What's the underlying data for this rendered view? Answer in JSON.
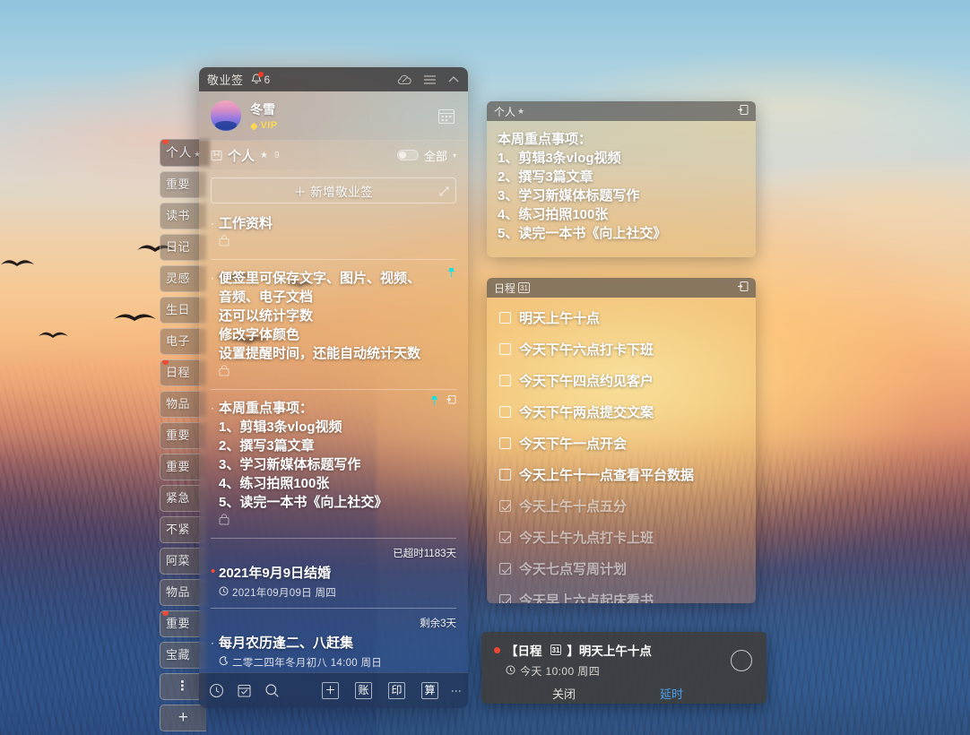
{
  "wallpaper": {
    "name": "sunset-dune-photo"
  },
  "sidebar": {
    "items": [
      {
        "label": "个人",
        "star": "★",
        "active": true,
        "dot": true
      },
      {
        "label": "重要"
      },
      {
        "label": "读书"
      },
      {
        "label": "日记"
      },
      {
        "label": "灵感"
      },
      {
        "label": "生日"
      },
      {
        "label": "电子"
      },
      {
        "label": "日程",
        "dot": true
      },
      {
        "label": "物品"
      },
      {
        "label": "重要"
      },
      {
        "label": "重要"
      },
      {
        "label": "紧急"
      },
      {
        "label": "不紧"
      },
      {
        "label": "阿菜"
      },
      {
        "label": "物品"
      },
      {
        "label": "重要",
        "dot": true
      },
      {
        "label": "宝藏"
      }
    ],
    "more_label": "⋮",
    "add_label": "+"
  },
  "app": {
    "titlebar": {
      "name": "敬业签",
      "notification_count": "6",
      "icons": [
        "cloud-sync-icon",
        "menu-icon",
        "collapse-icon"
      ]
    },
    "profile": {
      "username": "冬雪",
      "vip_label": "VIP",
      "gem": "◆",
      "calendar_icon": "calendar-icon"
    },
    "filterbar": {
      "group_icon": "folder-icon",
      "group_name": "个人",
      "star": "★",
      "count": "9",
      "toggle_state": "off",
      "filter_label": "全部",
      "caret": "▾"
    },
    "add_button": {
      "label": "＋ 新增敬业签"
    },
    "notes": [
      {
        "bullet": "·",
        "title": "工作资料",
        "lines": [
          "工作资料"
        ],
        "has_attachment": true
      },
      {
        "bullet": "·",
        "lines": [
          "便签里可保存文字、图片、视频、",
          "音频、电子文档",
          "还可以统计字数",
          "修改字体颜色",
          "设置提醒时间，还能自动统计天数"
        ],
        "has_attachment": true,
        "pinned": true
      },
      {
        "bullet": "·",
        "lines": [
          "本周重点事项：",
          "1、剪辑3条vlog视频",
          "2、撰写3篇文章",
          "3、学习新媒体标题写作",
          "4、练习拍照100张",
          "5、读完一本书《向上社交》"
        ],
        "has_attachment": true,
        "pinned": true,
        "meta": "已超时1183天"
      },
      {
        "bullet": "•",
        "bullet_color": "#ff4b36",
        "lines": [
          "2021年9月9日结婚"
        ],
        "sub_icon": "clock-icon",
        "sub": "2021年09月09日  周四",
        "meta_after": "剩余3天"
      },
      {
        "bullet": "·",
        "lines": [
          "每月农历逢二、八赶集"
        ],
        "sub_icon": "lunar-icon",
        "sub": "二零二四年冬月初八  14:00  周日"
      }
    ],
    "toolbar": {
      "left_icons": [
        "clock-icon",
        "checklist-icon",
        "search-icon"
      ],
      "right_buttons": [
        "＋",
        "账",
        "印",
        "算"
      ],
      "overflow": "⋮"
    }
  },
  "windows": [
    {
      "id": "personal",
      "title": "个人",
      "star": "★",
      "pin_icon": "pin-out-icon",
      "lines": [
        "本周重点事项：",
        "1、剪辑3条vlog视频",
        "2、撰写3篇文章",
        "3、学习新媒体标题写作",
        "4、练习拍照100张",
        "5、读完一本书《向上社交》"
      ]
    },
    {
      "id": "schedule",
      "title": "日程",
      "badge": "31",
      "pin_icon": "pin-out-icon",
      "todos": [
        {
          "label": "明天上午十点",
          "done": false
        },
        {
          "label": "今天下午六点打卡下班",
          "done": false
        },
        {
          "label": "今天下午四点约见客户",
          "done": false
        },
        {
          "label": "今天下午两点提交文案",
          "done": false
        },
        {
          "label": "今天下午一点开会",
          "done": false
        },
        {
          "label": "今天上午十一点查看平台数据",
          "done": false
        },
        {
          "label": "今天上午十点五分",
          "done": true
        },
        {
          "label": "今天上午九点打卡上班",
          "done": true
        },
        {
          "label": "今天七点写周计划",
          "done": true
        },
        {
          "label": "今天早上六点起床看书",
          "done": true
        }
      ]
    }
  ],
  "reminder": {
    "title_prefix": "【日程",
    "badge": "31",
    "title_suffix": "】明天上午十点",
    "clock_icon": "clock-icon",
    "time": "今天  10:00  周四",
    "close_label": "关闭",
    "snooze_label": "延时",
    "snooze_color": "#4aa3f0"
  }
}
